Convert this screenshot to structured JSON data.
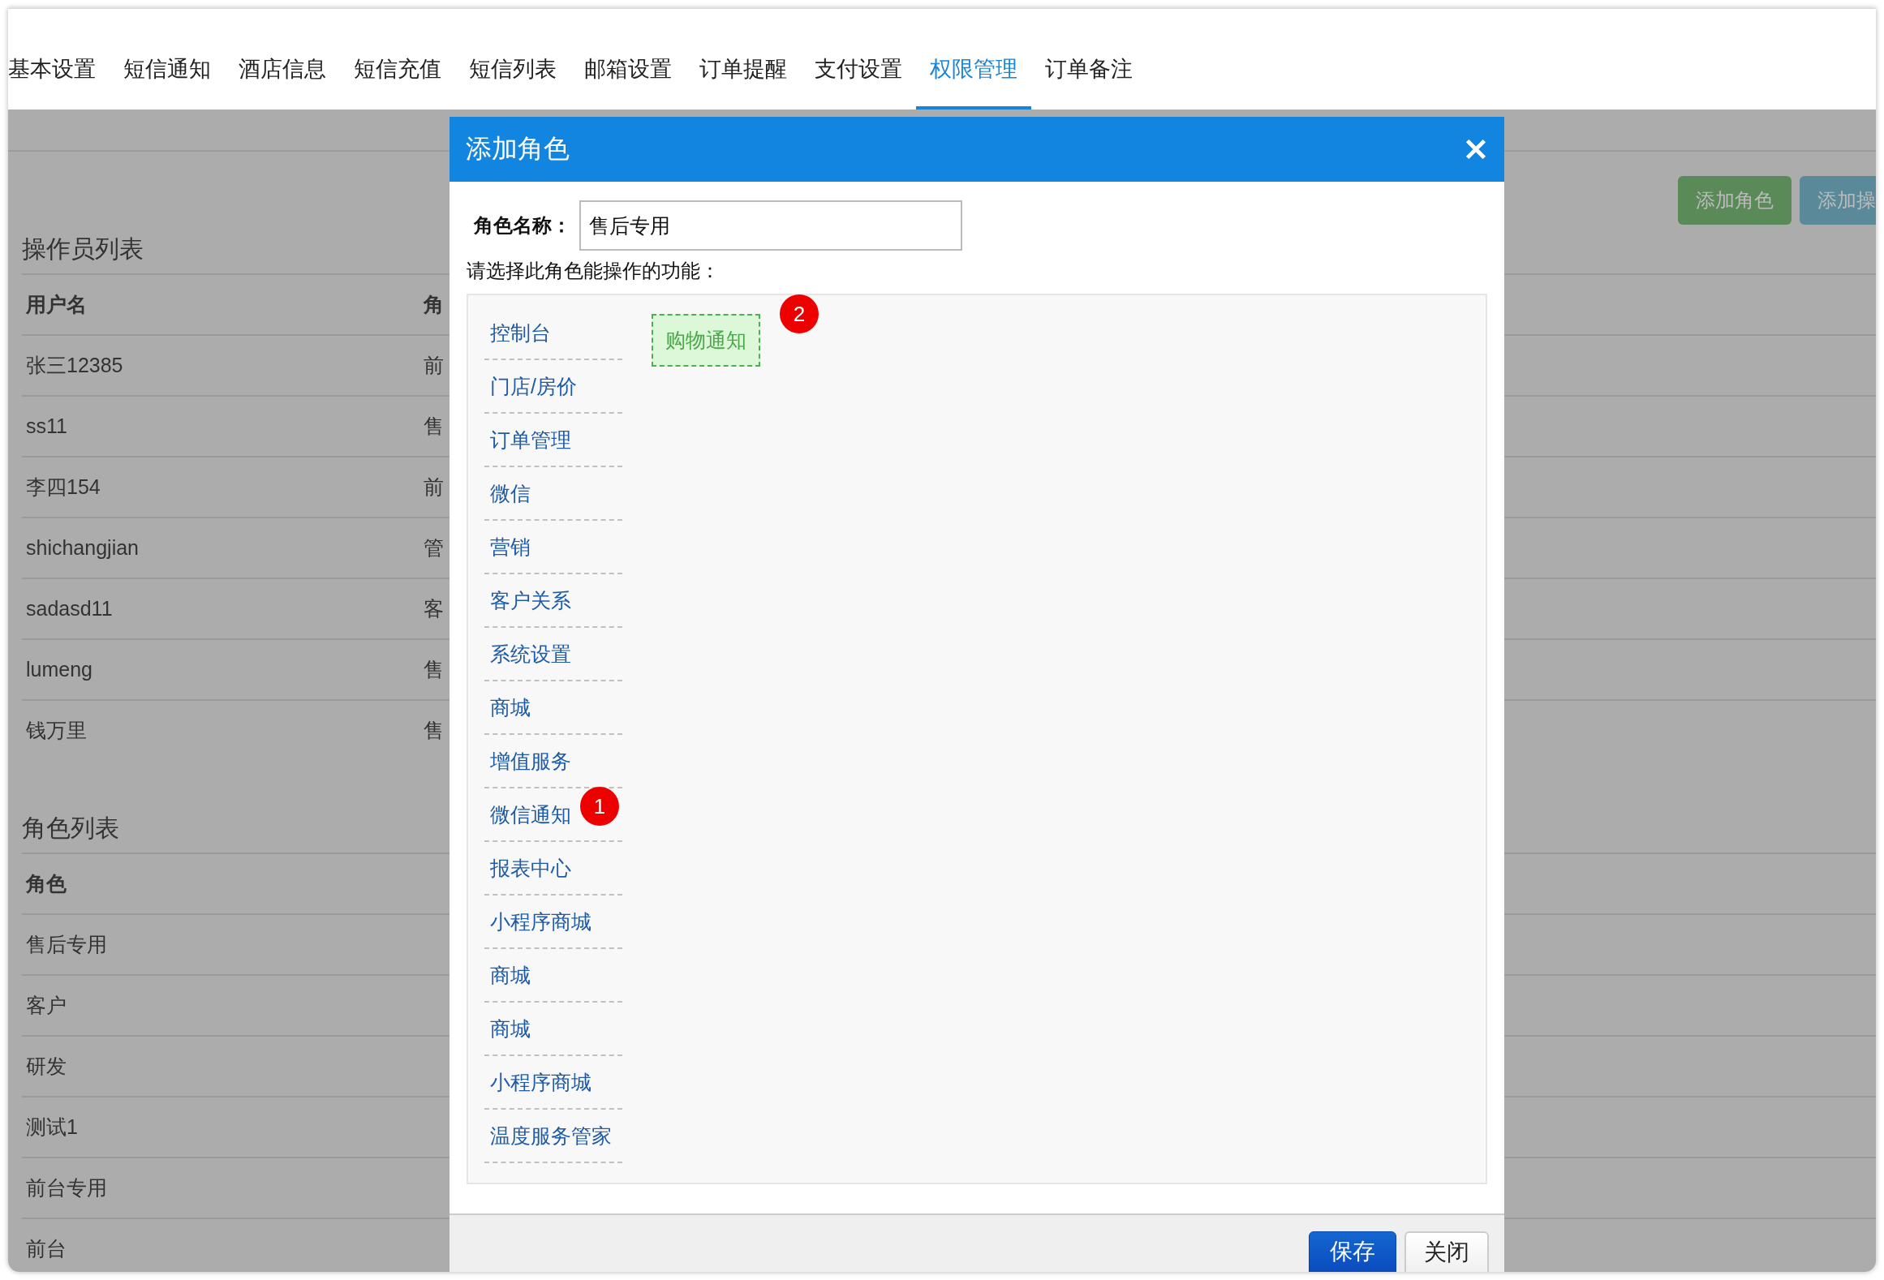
{
  "tabs": [
    {
      "label": "基本设置",
      "selected": false
    },
    {
      "label": "短信通知",
      "selected": false
    },
    {
      "label": "酒店信息",
      "selected": false
    },
    {
      "label": "短信充值",
      "selected": false
    },
    {
      "label": "短信列表",
      "selected": false
    },
    {
      "label": "邮箱设置",
      "selected": false
    },
    {
      "label": "订单提醒",
      "selected": false
    },
    {
      "label": "支付设置",
      "selected": false
    },
    {
      "label": "权限管理",
      "selected": true
    },
    {
      "label": "订单备注",
      "selected": false
    }
  ],
  "toolbar": {
    "buttons": [
      {
        "label": "添加角色",
        "kind": "success"
      },
      {
        "label": "添加操",
        "kind": "info"
      }
    ]
  },
  "operator_list": {
    "title": "操作员列表",
    "columns": [
      "用户名",
      "角"
    ],
    "rows": [
      [
        "张三12385",
        "前"
      ],
      [
        "ss11",
        "售"
      ],
      [
        "李四154",
        "前"
      ],
      [
        "shichangjian",
        "管"
      ],
      [
        "sadasd11",
        "客"
      ],
      [
        "lumeng",
        "售"
      ],
      [
        "钱万里",
        "售"
      ]
    ]
  },
  "role_list": {
    "title": "角色列表",
    "columns": [
      "角色"
    ],
    "rows": [
      "售后专用",
      "客户",
      "研发",
      "测试1",
      "前台专用",
      "前台"
    ]
  },
  "dialog": {
    "title": "添加角色",
    "name_label": "角色名称：",
    "name_value": "售后专用",
    "prompt": "请选择此角色能操作的功能：",
    "functions": [
      {
        "label": "控制台"
      },
      {
        "label": "门店/房价"
      },
      {
        "label": "订单管理"
      },
      {
        "label": "微信"
      },
      {
        "label": "营销"
      },
      {
        "label": "客户关系"
      },
      {
        "label": "系统设置"
      },
      {
        "label": "商城"
      },
      {
        "label": "增值服务"
      },
      {
        "label": "微信通知",
        "badge": "1"
      },
      {
        "label": "报表中心"
      },
      {
        "label": "小程序商城"
      },
      {
        "label": "商城"
      },
      {
        "label": "商城"
      },
      {
        "label": "小程序商城"
      },
      {
        "label": "温度服务管家"
      }
    ],
    "selected_functions": [
      {
        "label": "购物通知",
        "badge": "2"
      }
    ],
    "buttons": [
      {
        "label": "保存",
        "kind": "primary"
      },
      {
        "label": "关闭",
        "kind": "default"
      }
    ]
  }
}
